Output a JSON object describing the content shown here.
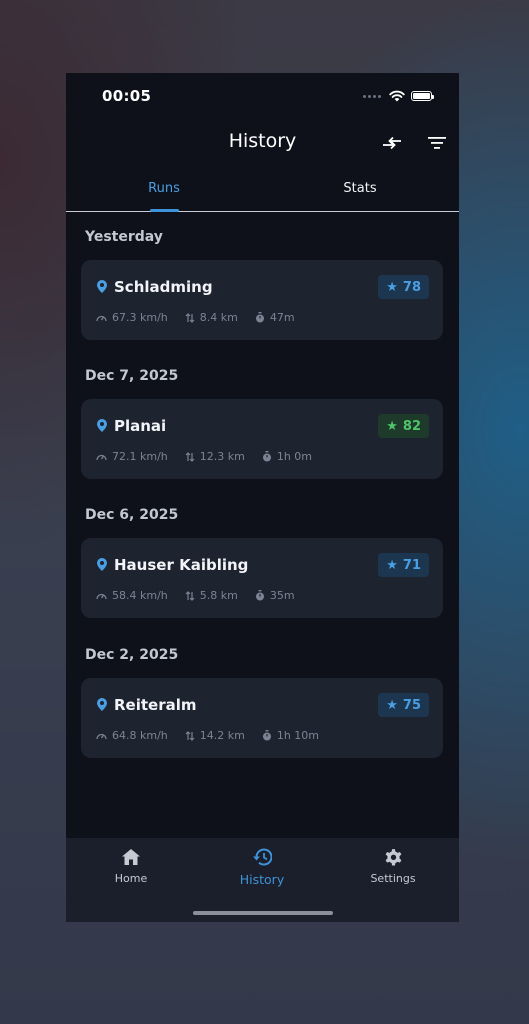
{
  "status_bar": {
    "time": "00:05"
  },
  "header": {
    "title": "History"
  },
  "tabs": [
    {
      "label": "Runs",
      "active": true
    },
    {
      "label": "Stats",
      "active": false
    }
  ],
  "groups": [
    {
      "date": "Yesterday",
      "runs": [
        {
          "resort": "Schladming",
          "score": "78",
          "score_color": "#4a9fe3",
          "speed": "67.3 km/h",
          "distance": "8.4 km",
          "duration": "47m"
        }
      ]
    },
    {
      "date": "Dec 7, 2025",
      "runs": [
        {
          "resort": "Planai",
          "score": "82",
          "score_color": "#4fc46a",
          "speed": "72.1 km/h",
          "distance": "12.3 km",
          "duration": "1h 0m"
        }
      ]
    },
    {
      "date": "Dec 6, 2025",
      "runs": [
        {
          "resort": "Hauser Kaibling",
          "score": "71",
          "score_color": "#4a9fe3",
          "speed": "58.4 km/h",
          "distance": "5.8 km",
          "duration": "35m"
        }
      ]
    },
    {
      "date": "Dec 2, 2025",
      "runs": [
        {
          "resort": "Reiteralm",
          "score": "75",
          "score_color": "#4a9fe3",
          "speed": "64.8 km/h",
          "distance": "14.2 km",
          "duration": "1h 10m"
        }
      ]
    }
  ],
  "bottom_nav": [
    {
      "label": "Home",
      "icon": "home-icon",
      "active": false
    },
    {
      "label": "History",
      "icon": "history-icon",
      "active": true
    },
    {
      "label": "Settings",
      "icon": "gear-icon",
      "active": false
    }
  ],
  "colors": {
    "accent": "#3e92d8",
    "background": "#0e1119",
    "card": "#1e2330",
    "score_green": "#4fc46a"
  }
}
